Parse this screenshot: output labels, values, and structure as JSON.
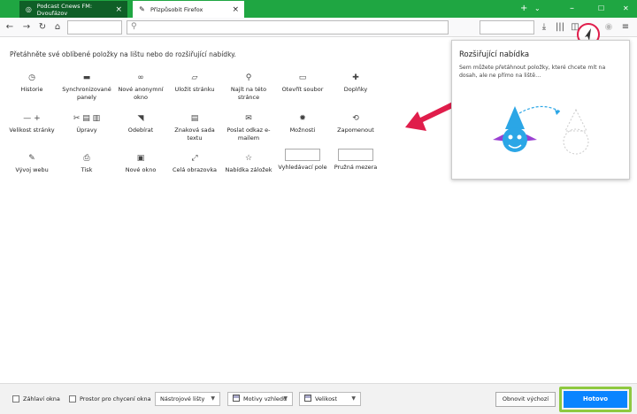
{
  "tabs": [
    {
      "title": "Podcast Cnews FM: Dvoufázov"
    },
    {
      "title": "Přizpůsobit Firefox"
    }
  ],
  "window_controls": {
    "minimize": "–",
    "maximize": "☐",
    "close": "✕",
    "new_tab": "+",
    "tab_list": "⌄"
  },
  "palette": {
    "instructions": "Přetáhněte své oblíbené položky na lištu nebo do rozšiřující nabídky.",
    "items": [
      {
        "label": "Historie",
        "icon": "history-icon",
        "glyph": "◷"
      },
      {
        "label": "Synchronizované panely",
        "icon": "synced-tabs-icon",
        "glyph": "▬"
      },
      {
        "label": "Nové anonymní okno",
        "icon": "private-window-icon",
        "glyph": "∞"
      },
      {
        "label": "Uložit stránku",
        "icon": "save-page-icon",
        "glyph": "▱"
      },
      {
        "label": "Najít na této stránce",
        "icon": "find-icon",
        "glyph": "⚲"
      },
      {
        "label": "Otevřít soubor",
        "icon": "open-file-icon",
        "glyph": "▭"
      },
      {
        "label": "Doplňky",
        "icon": "addons-icon",
        "glyph": "✚"
      },
      {
        "label": "Velikost stránky",
        "icon": "zoom-icon",
        "glyph": "— +"
      },
      {
        "label": "Úpravy",
        "icon": "edit-icon",
        "glyph": "✂ ▤ ▥"
      },
      {
        "label": "Odebírat",
        "icon": "feed-icon",
        "glyph": "◥"
      },
      {
        "label": "Znaková sada textu",
        "icon": "charset-icon",
        "glyph": "▤"
      },
      {
        "label": "Poslat odkaz e-mailem",
        "icon": "email-link-icon",
        "glyph": "✉"
      },
      {
        "label": "Možnosti",
        "icon": "options-icon",
        "glyph": "✹"
      },
      {
        "label": "Zapomenout",
        "icon": "forget-icon",
        "glyph": "⟲"
      },
      {
        "label": "Vývoj webu",
        "icon": "developer-icon",
        "glyph": "✎"
      },
      {
        "label": "Tisk",
        "icon": "print-icon",
        "glyph": "⎙"
      },
      {
        "label": "Nové okno",
        "icon": "new-window-icon",
        "glyph": "▣"
      },
      {
        "label": "Celá obrazovka",
        "icon": "fullscreen-icon",
        "glyph": "⤢"
      },
      {
        "label": "Nabídka záložek",
        "icon": "bookmarks-menu-icon",
        "glyph": "☆"
      },
      {
        "label": "Vyhledávací pole",
        "icon": "search-field-icon",
        "glyph": ""
      },
      {
        "label": "Pružná mezera",
        "icon": "flexible-space-icon",
        "glyph": ""
      }
    ]
  },
  "overflow_panel": {
    "title": "Rozšiřující nabídka",
    "description": "Sem můžete přetáhnout položky, které chcete mít na dosah, ale ne přímo na liště…"
  },
  "footer": {
    "title_bar_label": "Záhlaví okna",
    "drag_space_label": "Prostor pro chycení okna",
    "toolbars_label": "Nástrojové lišty",
    "themes_label": "Motivy vzhledu",
    "density_label": "Velikost",
    "restore_defaults_label": "Obnovit výchozí",
    "done_label": "Hotovo"
  },
  "colors": {
    "tabbar": "#1fa642",
    "accent": "#0a84ff",
    "highlight_green": "#8ec940",
    "annotation_red": "#e01d4b"
  }
}
